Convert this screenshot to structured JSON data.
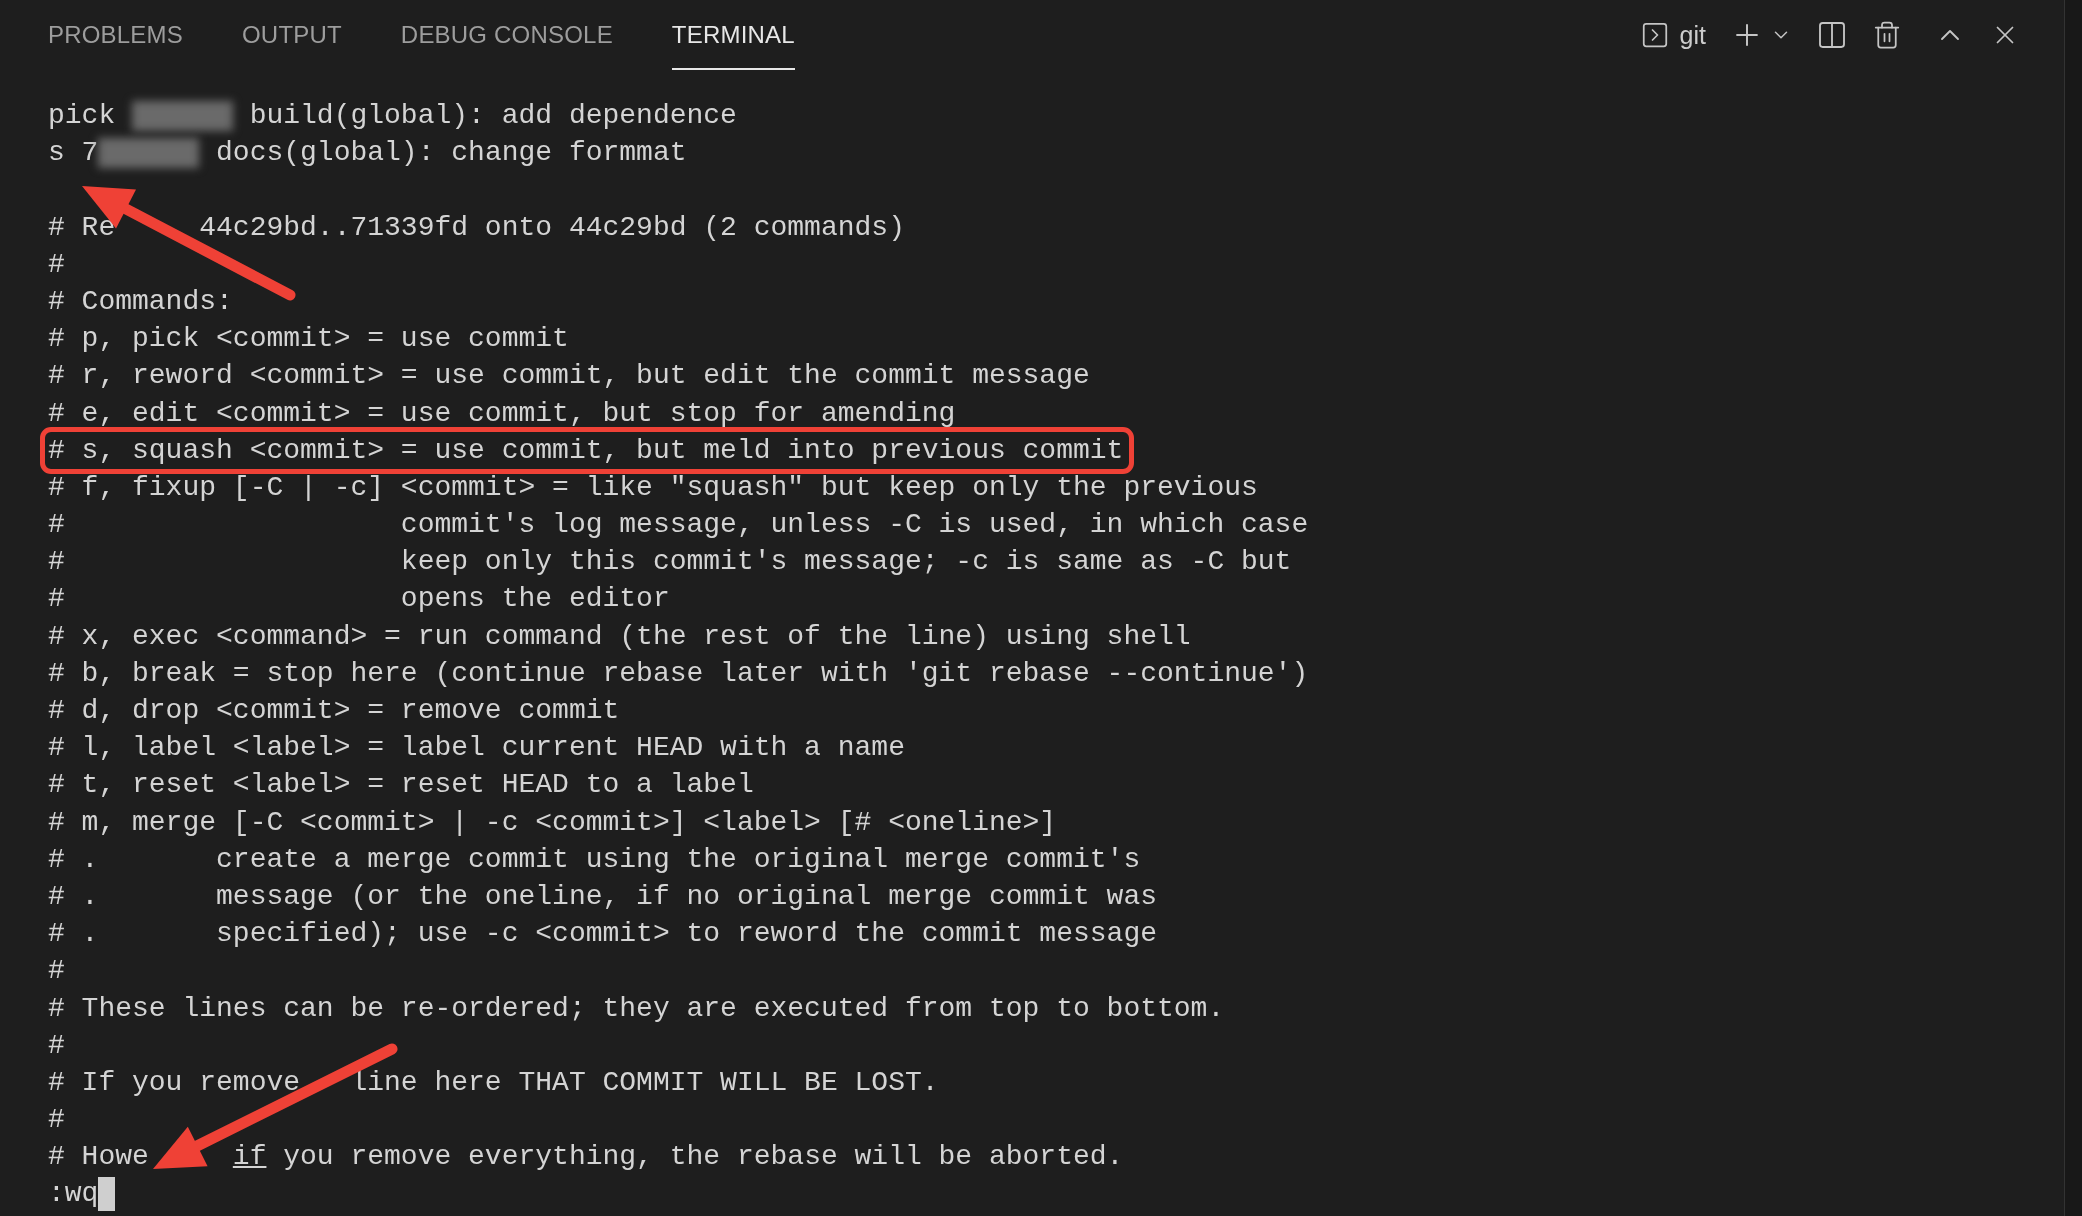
{
  "tabs": [
    {
      "label": "PROBLEMS",
      "selected": false
    },
    {
      "label": "OUTPUT",
      "selected": false
    },
    {
      "label": "DEBUG CONSOLE",
      "selected": false
    },
    {
      "label": "TERMINAL",
      "selected": true
    }
  ],
  "terminal_name": "git",
  "lines": [
    {
      "highlighted": false,
      "parts": [
        {
          "kind": "text",
          "text": "pick "
        },
        {
          "kind": "redacted"
        },
        {
          "kind": "text",
          "text": " build(global): add dependence"
        }
      ]
    },
    {
      "highlighted": false,
      "parts": [
        {
          "kind": "text",
          "text": "s 7"
        },
        {
          "kind": "redacted"
        },
        {
          "kind": "text",
          "text": " docs(global): change formmat"
        }
      ]
    },
    {
      "highlighted": false
    },
    {
      "highlighted": false,
      "parts": [
        {
          "kind": "text",
          "text": "# Re"
        },
        {
          "kind": "covered"
        },
        {
          "kind": "text",
          "text": "44c29bd..71339fd onto 44c29bd (2 commands)"
        }
      ]
    },
    {
      "highlighted": false,
      "parts": [
        {
          "kind": "text",
          "text": "#"
        }
      ]
    },
    {
      "highlighted": false,
      "parts": [
        {
          "kind": "text",
          "text": "# Commands:"
        }
      ]
    },
    {
      "highlighted": false,
      "parts": [
        {
          "kind": "text",
          "text": "# p, pick <commit> = use commit"
        }
      ]
    },
    {
      "highlighted": false,
      "parts": [
        {
          "kind": "text",
          "text": "# r, reword <commit> = use commit, but edit the commit message"
        }
      ]
    },
    {
      "highlighted": false,
      "parts": [
        {
          "kind": "text",
          "text": "# e, edit <commit> = use commit, but stop for amending"
        }
      ]
    },
    {
      "highlighted": true,
      "parts": [
        {
          "kind": "text",
          "text": "# s, squash <commit> = use commit, but meld into previous commit"
        }
      ]
    },
    {
      "highlighted": false,
      "parts": [
        {
          "kind": "text",
          "text": "# f, fixup [-C | -c] <commit> = like \"squash\" but keep only the previous"
        }
      ]
    },
    {
      "highlighted": false,
      "parts": [
        {
          "kind": "text",
          "text": "#                    commit's log message, unless -C is used, in which case"
        }
      ]
    },
    {
      "highlighted": false,
      "parts": [
        {
          "kind": "text",
          "text": "#                    keep only this commit's message; -c is same as -C but"
        }
      ]
    },
    {
      "highlighted": false,
      "parts": [
        {
          "kind": "text",
          "text": "#                    opens the editor"
        }
      ]
    },
    {
      "highlighted": false,
      "parts": [
        {
          "kind": "text",
          "text": "# x, exec <command> = run command (the rest of the line) using shell"
        }
      ]
    },
    {
      "highlighted": false,
      "parts": [
        {
          "kind": "text",
          "text": "# b, break = stop here (continue rebase later with 'git rebase --continue')"
        }
      ]
    },
    {
      "highlighted": false,
      "parts": [
        {
          "kind": "text",
          "text": "# d, drop <commit> = remove commit"
        }
      ]
    },
    {
      "highlighted": false,
      "parts": [
        {
          "kind": "text",
          "text": "# l, label <label> = label current HEAD with a name"
        }
      ]
    },
    {
      "highlighted": false,
      "parts": [
        {
          "kind": "text",
          "text": "# t, reset <label> = reset HEAD to a label"
        }
      ]
    },
    {
      "highlighted": false,
      "parts": [
        {
          "kind": "text",
          "text": "# m, merge [-C <commit> | -c <commit>] <label> [# <oneline>]"
        }
      ]
    },
    {
      "highlighted": false,
      "parts": [
        {
          "kind": "text",
          "text": "# .       create a merge commit using the original merge commit's"
        }
      ]
    },
    {
      "highlighted": false,
      "parts": [
        {
          "kind": "text",
          "text": "# .       message (or the oneline, if no original merge commit was"
        }
      ]
    },
    {
      "highlighted": false,
      "parts": [
        {
          "kind": "text",
          "text": "# .       specified); use -c <commit> to reword the commit message"
        }
      ]
    },
    {
      "highlighted": false,
      "parts": [
        {
          "kind": "text",
          "text": "#"
        }
      ]
    },
    {
      "highlighted": false,
      "parts": [
        {
          "kind": "text",
          "text": "# These lines can be re-ordered; they are executed from top to bottom."
        }
      ]
    },
    {
      "highlighted": false,
      "parts": [
        {
          "kind": "text",
          "text": "#"
        }
      ]
    },
    {
      "highlighted": false,
      "parts": [
        {
          "kind": "text",
          "text": "# If you remove "
        },
        {
          "kind": "covered_letter"
        },
        {
          "kind": "text",
          "text": " line here THAT COMMIT WILL BE LOST."
        }
      ]
    },
    {
      "highlighted": false,
      "parts": [
        {
          "kind": "text",
          "text": "#"
        }
      ]
    },
    {
      "highlighted": false,
      "parts": [
        {
          "kind": "text",
          "text": "# Howe"
        },
        {
          "kind": "covered"
        },
        {
          "kind": "underline",
          "text": "if"
        },
        {
          "kind": "text",
          "text": " you remove everything, the rebase will be aborted."
        }
      ]
    },
    {
      "highlighted": false,
      "parts": [
        {
          "kind": "text",
          "text": ":wq"
        },
        {
          "kind": "cursor"
        }
      ]
    }
  ]
}
